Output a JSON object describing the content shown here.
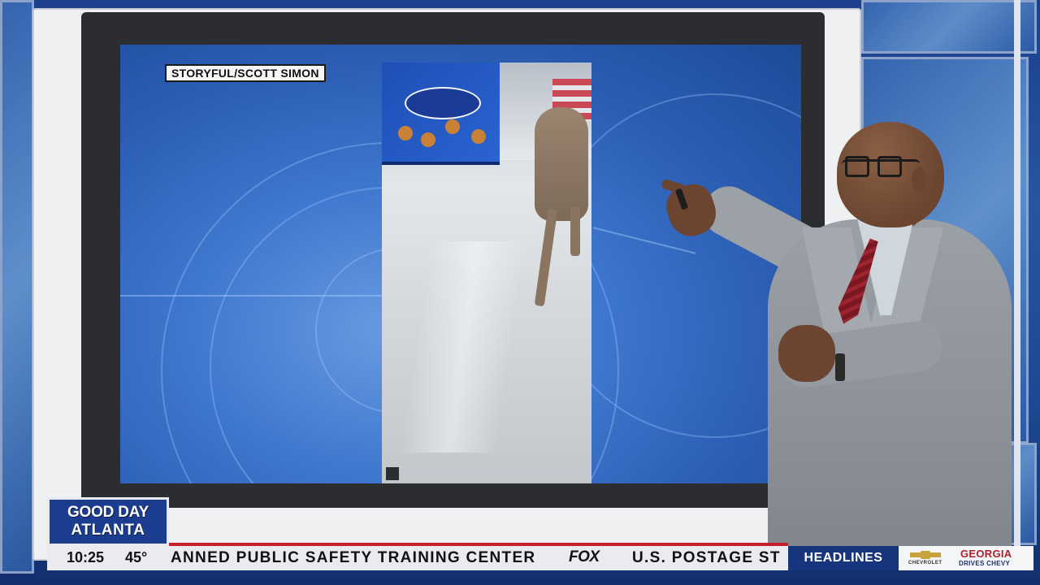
{
  "video": {
    "credit": "STORYFUL/SCOTT SIMON"
  },
  "show": {
    "logo_line1": "GOOD DAY",
    "logo_line2": "ATLANTA"
  },
  "ticker": {
    "time": "10:25",
    "temperature": "45°",
    "crawl_text": "ANNED PUBLIC SAFETY TRAINING CENTER",
    "network": "FOX",
    "crawl_text_next": "U.S. POSTAGE ST",
    "section_label": "HEADLINES"
  },
  "sponsor": {
    "line1": "GEORGIA",
    "line2": "DRIVES CHEVY",
    "brand": "CHEVROLET"
  },
  "colors": {
    "logo_blue": "#1c3d8f",
    "headline_blue": "#17357d",
    "accent_red": "#c41f2b"
  }
}
